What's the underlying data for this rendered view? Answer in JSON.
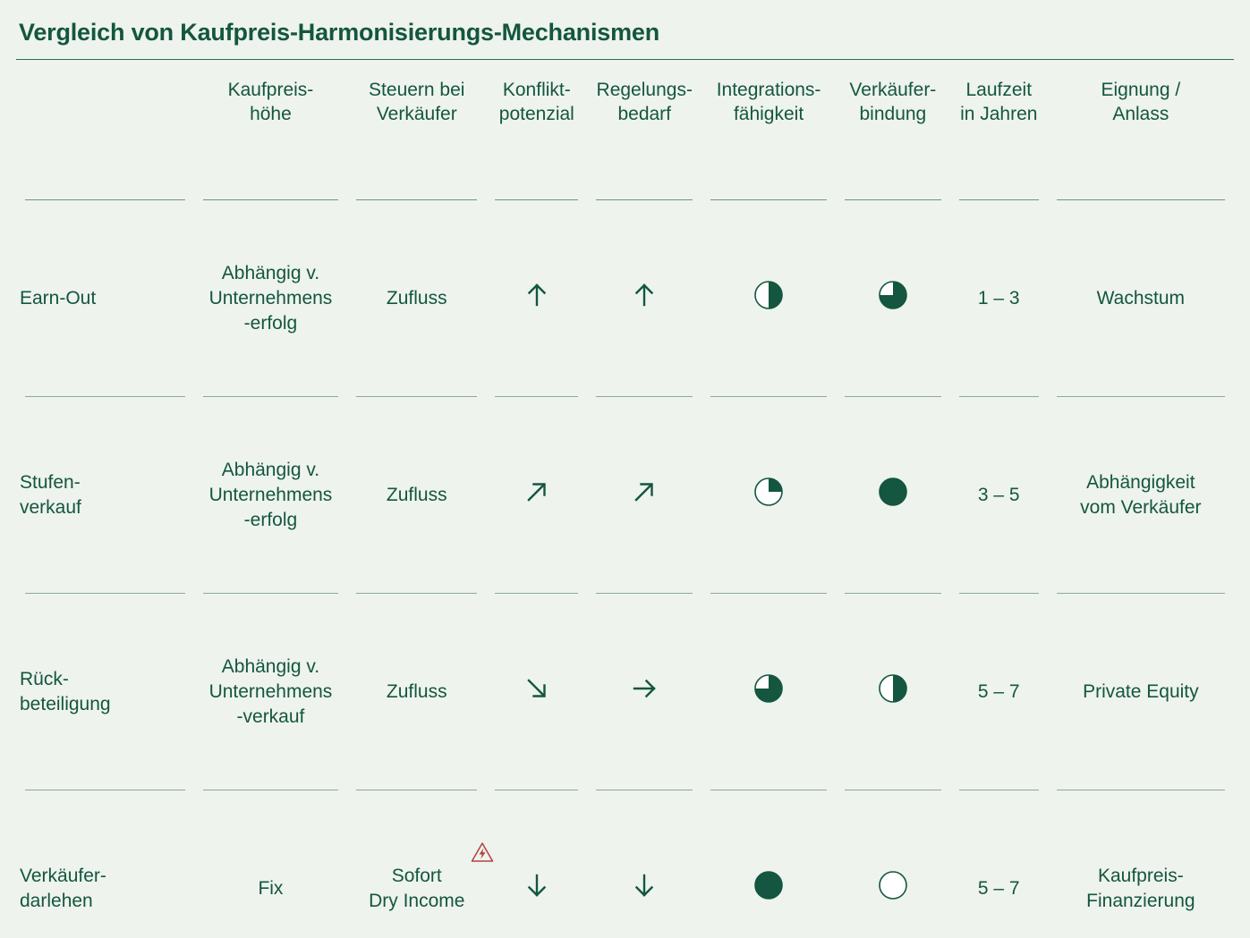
{
  "header": {
    "title": "Vergleich von Kaufpreis-Harmonisierungs-Mechanismen"
  },
  "colors": {
    "background": "#eef3ee",
    "accent": "#14563f",
    "rule": "#2f6b55",
    "separator": "#8fa79b",
    "warning": "#b5413c"
  },
  "table": {
    "columns": [
      {
        "key": "mechanism",
        "line1": "",
        "line2": ""
      },
      {
        "key": "price",
        "line1": "Kaufpreis-",
        "line2": "höhe"
      },
      {
        "key": "tax",
        "line1": "Steuern bei",
        "line2": "Verkäufer"
      },
      {
        "key": "conflict",
        "line1": "Konflikt-",
        "line2": "potenzial"
      },
      {
        "key": "regulation",
        "line1": "Regelungs-",
        "line2": "bedarf"
      },
      {
        "key": "integration",
        "line1": "Integrations-",
        "line2": "fähigkeit"
      },
      {
        "key": "binding",
        "line1": "Verkäufer-",
        "line2": "bindung"
      },
      {
        "key": "term",
        "line1": "Laufzeit",
        "line2": "in Jahren"
      },
      {
        "key": "suitability",
        "line1": "Eignung /",
        "line2": "Anlass"
      }
    ],
    "rows": [
      {
        "mechanism_l1": "Earn-Out",
        "mechanism_l2": "",
        "price_l1": "Abhängig v.",
        "price_l2": "Unternehmens",
        "price_l3": "-erfolg",
        "tax_l1": "Zufluss",
        "tax_l2": "",
        "tax_warning": false,
        "conflict_icon": "arrow-up",
        "regulation_icon": "arrow-up",
        "integration_fill": 50,
        "integration_icon": "pie-half",
        "binding_fill": 75,
        "binding_icon": "pie-three-quarter",
        "term": "1 – 3",
        "suitability_l1": "Wachstum",
        "suitability_l2": ""
      },
      {
        "mechanism_l1": "Stufen-",
        "mechanism_l2": "verkauf",
        "price_l1": "Abhängig v.",
        "price_l2": "Unternehmens",
        "price_l3": "-erfolg",
        "tax_l1": "Zufluss",
        "tax_l2": "",
        "tax_warning": false,
        "conflict_icon": "arrow-up-right",
        "regulation_icon": "arrow-up-right",
        "integration_fill": 25,
        "integration_icon": "pie-quarter",
        "binding_fill": 100,
        "binding_icon": "pie-full",
        "term": "3 – 5",
        "suitability_l1": "Abhängigkeit",
        "suitability_l2": "vom Verkäufer"
      },
      {
        "mechanism_l1": "Rück-",
        "mechanism_l2": "beteiligung",
        "price_l1": "Abhängig v.",
        "price_l2": "Unternehmens",
        "price_l3": "-verkauf",
        "tax_l1": "Zufluss",
        "tax_l2": "",
        "tax_warning": false,
        "conflict_icon": "arrow-down-right",
        "regulation_icon": "arrow-right",
        "integration_fill": 75,
        "integration_icon": "pie-three-quarter",
        "binding_fill": 50,
        "binding_icon": "pie-half",
        "term": "5 – 7",
        "suitability_l1": "Private Equity",
        "suitability_l2": ""
      },
      {
        "mechanism_l1": "Verkäufer-",
        "mechanism_l2": "darlehen",
        "price_l1": "Fix",
        "price_l2": "",
        "price_l3": "",
        "tax_l1": "Sofort",
        "tax_l2": "Dry Income",
        "tax_warning": true,
        "conflict_icon": "arrow-down",
        "regulation_icon": "arrow-down",
        "integration_fill": 100,
        "integration_icon": "pie-full",
        "binding_fill": 0,
        "binding_icon": "pie-empty",
        "term": "5 – 7",
        "suitability_l1": "Kaufpreis-",
        "suitability_l2": "Finanzierung"
      }
    ]
  }
}
